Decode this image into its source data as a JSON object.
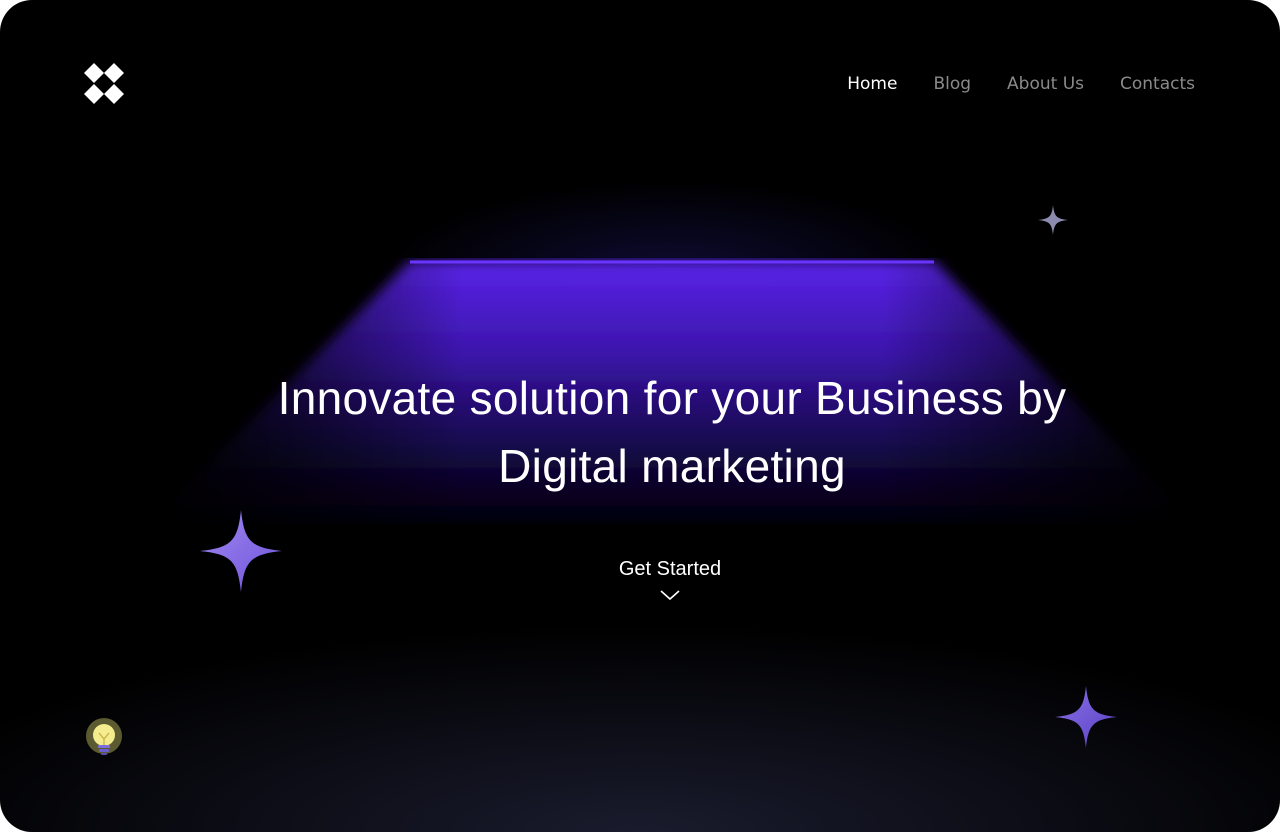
{
  "nav": {
    "items": [
      {
        "label": "Home",
        "active": true
      },
      {
        "label": "Blog",
        "active": false
      },
      {
        "label": "About Us",
        "active": false
      },
      {
        "label": "Contacts",
        "active": false
      }
    ]
  },
  "hero": {
    "title_line1": "Innovate solution for your Business by",
    "title_line2": "Digital marketing"
  },
  "cta": {
    "label": "Get Started"
  },
  "icons": {
    "logo": "four-diamond-logo-icon",
    "chevron": "chevron-down-icon",
    "sparkle": "four-point-star-icon",
    "bulb": "lightbulb-icon"
  },
  "colors": {
    "background": "#000000",
    "beam_top": "#5a24e6",
    "beam_fade": "#1a0a55",
    "sparkle_large": "#8e76e8",
    "sparkle_small": "#a6a3c8",
    "bulb_glow": "#f2e98a",
    "text_primary": "#ffffff",
    "text_muted": "#8a8a8a"
  }
}
